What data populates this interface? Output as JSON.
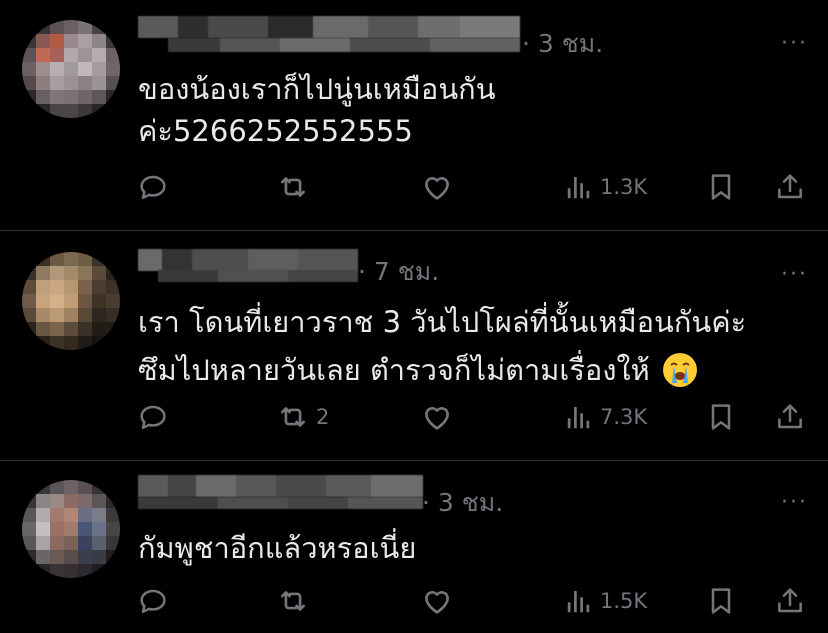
{
  "tweets": [
    {
      "time": "· 3 ชม.",
      "more": "···",
      "text_lines": [
        "ของน้องเราก็ไปนู่นเหมือนกัน",
        "ค่ะ5266252552555"
      ],
      "actions": {
        "reply": "",
        "retweet": "",
        "like": "",
        "views": "1.3K"
      }
    },
    {
      "time": "· 7 ชม.",
      "more": "···",
      "text_lines": [
        "เรา โดนที่เยาวราช 3 วันไปโผล่ที่นั้นเหมือนกันค่ะ",
        "ซึมไปหลายวันเลย ตำรวจก็ไม่ตามเรื่องให้"
      ],
      "emoji": "loudly-crying-face",
      "actions": {
        "reply": "",
        "retweet": "2",
        "like": "",
        "views": "7.3K"
      }
    },
    {
      "time": "· 3 ชม.",
      "more": "···",
      "text_lines": [
        "กัมพูชาอีกแล้วหรอเนี่ย"
      ],
      "actions": {
        "reply": "",
        "retweet": "",
        "like": "",
        "views": "1.5K"
      }
    }
  ],
  "icons": [
    "reply-icon",
    "retweet-icon",
    "like-icon",
    "views-icon",
    "bookmark-icon",
    "share-icon"
  ],
  "colors": {
    "background": "#000000",
    "text": "#e7e9ea",
    "muted": "#71767b",
    "divider": "#2f3336"
  }
}
